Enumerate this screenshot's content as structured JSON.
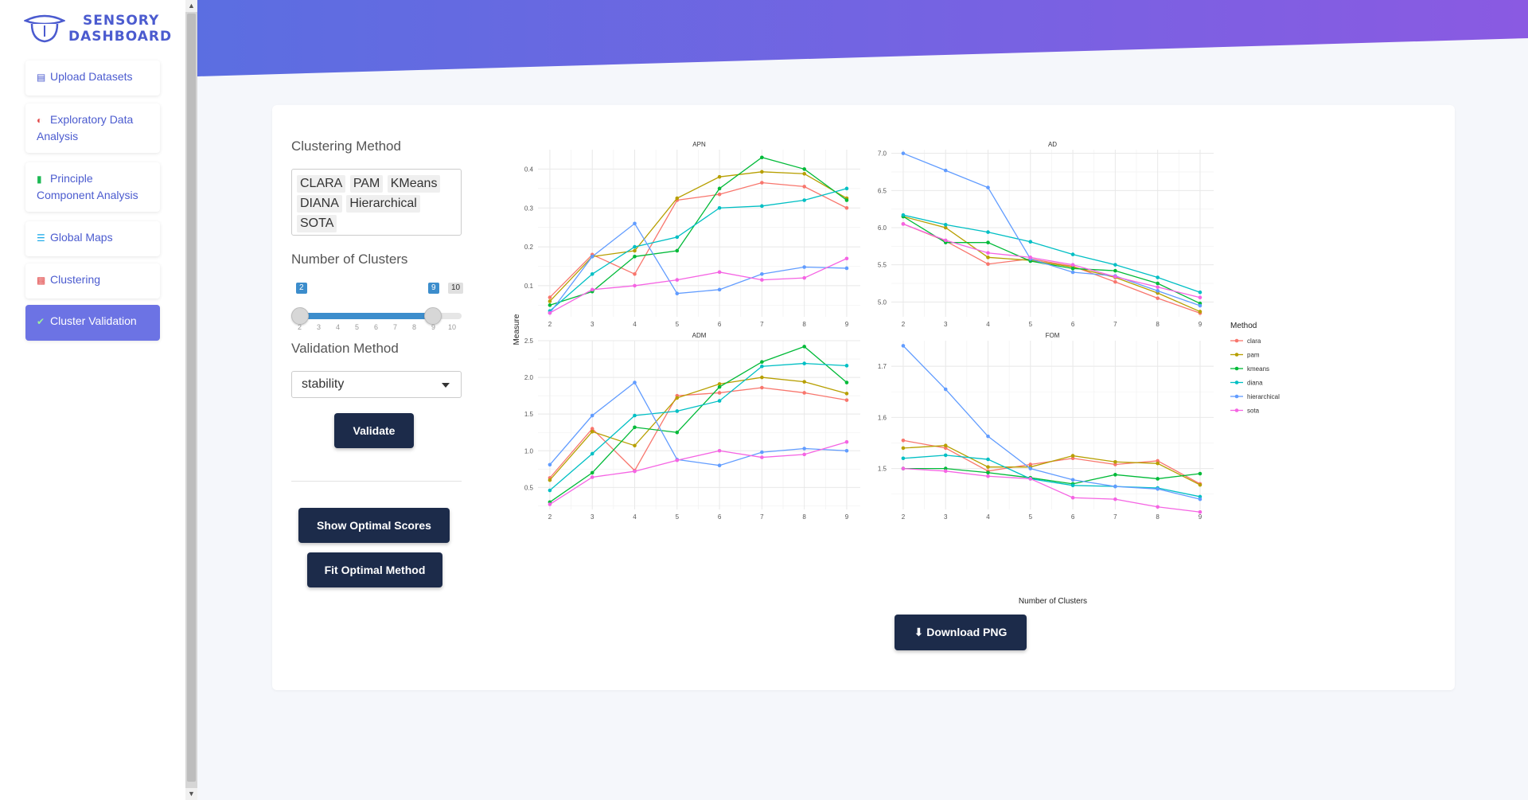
{
  "brand": {
    "line1": "SENSORY",
    "line2": "DASHBOARD"
  },
  "sidebar": {
    "items": [
      {
        "label": "Upload Datasets",
        "icon": "file-icon"
      },
      {
        "label": "Exploratory Data Analysis",
        "icon": "pie-chart-icon"
      },
      {
        "label": "Principle Component Analysis",
        "icon": "bar-chart-icon"
      },
      {
        "label": "Global Maps",
        "icon": "barcode-icon"
      },
      {
        "label": "Clustering",
        "icon": "sitemap-icon"
      },
      {
        "label": "Cluster Validation",
        "icon": "check-icon",
        "active": true
      }
    ]
  },
  "controls": {
    "clustering_method_label": "Clustering Method",
    "methods": [
      "CLARA",
      "PAM",
      "KMeans",
      "DIANA",
      "Hierarchical",
      "SOTA"
    ],
    "clusters_label": "Number of Clusters",
    "slider": {
      "min": 2,
      "max": 10,
      "from": 2,
      "to": 9,
      "ticks": [
        "2",
        "3",
        "4",
        "5",
        "6",
        "7",
        "8",
        "9",
        "10"
      ]
    },
    "validation_label": "Validation Method",
    "validation_value": "stability",
    "validate_button": "Validate",
    "optimal_scores_button": "Show Optimal Scores",
    "fit_optimal_button": "Fit Optimal Method",
    "download_button": "Download PNG"
  },
  "colors": {
    "accent": "#6c73e4",
    "dark_button": "#1c2b4a",
    "clara": "#F8766D",
    "pam": "#B79F00",
    "kmeans": "#00BA38",
    "diana": "#00BFC4",
    "hierarchical": "#619CFF",
    "sota": "#F564E3"
  },
  "chart_data": {
    "type": "line",
    "xlabel": "Number of Clusters",
    "ylabel": "Measure",
    "legend_title": "Method",
    "legend_position": "right",
    "x": [
      2,
      3,
      4,
      5,
      6,
      7,
      8,
      9
    ],
    "series_names": [
      "clara",
      "pam",
      "kmeans",
      "diana",
      "hierarchical",
      "sota"
    ],
    "panels": [
      {
        "title": "APN",
        "ylim": [
          0.02,
          0.45
        ],
        "yticks": [
          0.1,
          0.2,
          0.3,
          0.4
        ],
        "ytick_labels": [
          "0.1",
          "0.2",
          "0.3",
          "0.4"
        ],
        "series": [
          {
            "name": "clara",
            "values": [
              0.07,
              0.18,
              0.13,
              0.32,
              0.335,
              0.365,
              0.355,
              0.3
            ]
          },
          {
            "name": "pam",
            "values": [
              0.06,
              0.175,
              0.19,
              0.325,
              0.38,
              0.393,
              0.388,
              0.325
            ]
          },
          {
            "name": "kmeans",
            "values": [
              0.05,
              0.085,
              0.175,
              0.19,
              0.35,
              0.43,
              0.4,
              0.32
            ]
          },
          {
            "name": "diana",
            "values": [
              0.035,
              0.13,
              0.2,
              0.225,
              0.3,
              0.305,
              0.32,
              0.35
            ]
          },
          {
            "name": "hierarchical",
            "values": [
              0.03,
              0.175,
              0.26,
              0.08,
              0.09,
              0.13,
              0.148,
              0.145
            ]
          },
          {
            "name": "sota",
            "values": [
              0.03,
              0.09,
              0.1,
              0.115,
              0.135,
              0.115,
              0.12,
              0.17
            ]
          }
        ]
      },
      {
        "title": "AD",
        "ylim": [
          4.8,
          7.05
        ],
        "yticks": [
          5.0,
          5.5,
          6.0,
          6.5,
          7.0
        ],
        "ytick_labels": [
          "5.0",
          "5.5",
          "6.0",
          "6.5",
          "7.0"
        ],
        "series": [
          {
            "name": "clara",
            "values": [
              6.05,
              5.82,
              5.51,
              5.58,
              5.48,
              5.27,
              5.05,
              4.85
            ]
          },
          {
            "name": "pam",
            "values": [
              6.15,
              6.0,
              5.6,
              5.56,
              5.47,
              5.33,
              5.12,
              4.87
            ]
          },
          {
            "name": "kmeans",
            "values": [
              6.15,
              5.8,
              5.8,
              5.55,
              5.45,
              5.42,
              5.25,
              4.98
            ]
          },
          {
            "name": "diana",
            "values": [
              6.17,
              6.04,
              5.94,
              5.81,
              5.64,
              5.5,
              5.33,
              5.13
            ]
          },
          {
            "name": "hierarchical",
            "values": [
              7.0,
              6.77,
              6.54,
              5.58,
              5.4,
              5.35,
              5.15,
              4.95
            ]
          },
          {
            "name": "sota",
            "values": [
              6.05,
              5.83,
              5.66,
              5.6,
              5.5,
              5.34,
              5.2,
              5.06
            ]
          }
        ]
      },
      {
        "title": "ADM",
        "ylim": [
          0.2,
          2.5
        ],
        "yticks": [
          0.5,
          1.0,
          1.5,
          2.0,
          2.5
        ],
        "ytick_labels": [
          "0.5",
          "1.0",
          "1.5",
          "2.0",
          "2.5"
        ],
        "series": [
          {
            "name": "clara",
            "values": [
              0.63,
              1.3,
              0.73,
              1.75,
              1.79,
              1.86,
              1.79,
              1.69
            ]
          },
          {
            "name": "pam",
            "values": [
              0.6,
              1.26,
              1.07,
              1.72,
              1.91,
              2.0,
              1.94,
              1.78
            ]
          },
          {
            "name": "kmeans",
            "values": [
              0.3,
              0.7,
              1.32,
              1.25,
              1.87,
              2.21,
              2.42,
              1.93
            ]
          },
          {
            "name": "diana",
            "values": [
              0.46,
              0.96,
              1.48,
              1.54,
              1.68,
              2.15,
              2.19,
              2.16
            ]
          },
          {
            "name": "hierarchical",
            "values": [
              0.81,
              1.48,
              1.93,
              0.88,
              0.8,
              0.98,
              1.03,
              1.0
            ]
          },
          {
            "name": "sota",
            "values": [
              0.27,
              0.64,
              0.72,
              0.87,
              1.0,
              0.91,
              0.95,
              1.12
            ]
          }
        ]
      },
      {
        "title": "FOM",
        "ylim": [
          1.42,
          1.75
        ],
        "yticks": [
          1.5,
          1.6,
          1.7
        ],
        "ytick_labels": [
          "1.5",
          "1.6",
          "1.7"
        ],
        "series": [
          {
            "name": "clara",
            "values": [
              1.555,
              1.54,
              1.495,
              1.508,
              1.52,
              1.508,
              1.515,
              1.47
            ]
          },
          {
            "name": "pam",
            "values": [
              1.54,
              1.545,
              1.503,
              1.503,
              1.525,
              1.513,
              1.51,
              1.468
            ]
          },
          {
            "name": "kmeans",
            "values": [
              1.5,
              1.5,
              1.492,
              1.482,
              1.47,
              1.488,
              1.48,
              1.49
            ]
          },
          {
            "name": "diana",
            "values": [
              1.52,
              1.526,
              1.518,
              1.48,
              1.467,
              1.465,
              1.462,
              1.445
            ]
          },
          {
            "name": "hierarchical",
            "values": [
              1.74,
              1.655,
              1.563,
              1.5,
              1.478,
              1.465,
              1.46,
              1.44
            ]
          },
          {
            "name": "sota",
            "values": [
              1.5,
              1.495,
              1.485,
              1.48,
              1.443,
              1.44,
              1.425,
              1.415
            ]
          }
        ]
      }
    ]
  }
}
